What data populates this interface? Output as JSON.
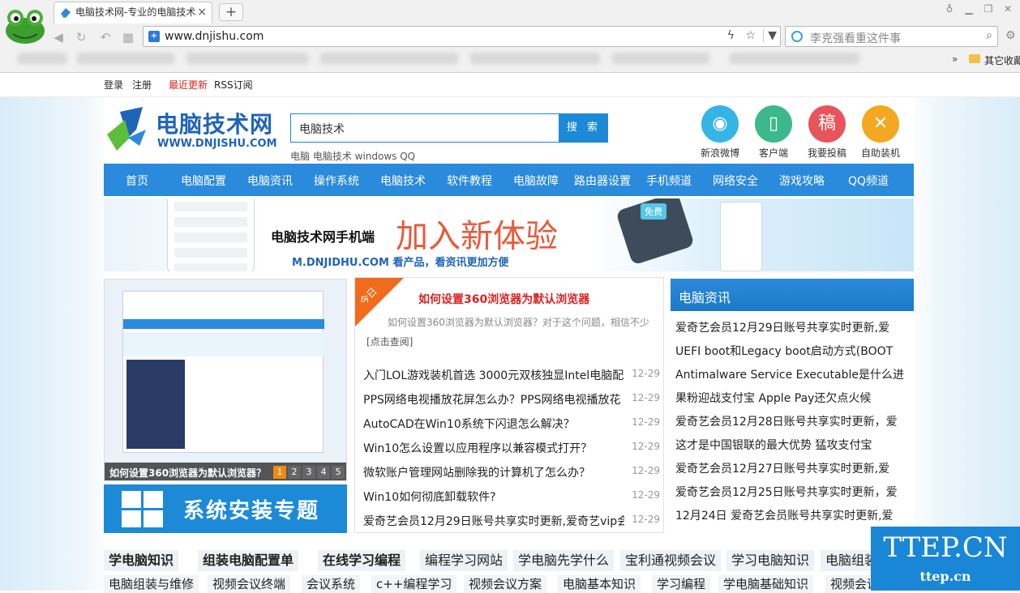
{
  "browser": {
    "tab_title": "电脑技术网-专业的电脑技术",
    "new_tab": "+",
    "url": "www.dnjishu.com",
    "search_placeholder": "李克强看重这件事",
    "bookmark_more": "»",
    "bookmark_other": "其它收藏"
  },
  "topbar": {
    "login": "登录",
    "register": "注册",
    "recent": "最近更新",
    "rss": "RSS订阅"
  },
  "site": {
    "logo_cn": "电脑技术网",
    "logo_en": "WWW.DNJISHU.COM",
    "search_value": "电脑技术",
    "search_button": "搜 索",
    "hot_words": "电脑 电脑技术 windows QQ",
    "quick_links": [
      {
        "label": "新浪微博",
        "icon": "weibo-icon",
        "color": "#35b4e6"
      },
      {
        "label": "客户端",
        "icon": "mobile-icon",
        "color": "#3cb88c"
      },
      {
        "label": "我要投稿",
        "icon": "submit-icon",
        "color": "#e9545a",
        "glyph": "稿"
      },
      {
        "label": "自助装机",
        "icon": "tools-icon",
        "color": "#f4a720"
      }
    ]
  },
  "nav": [
    "首页",
    "电脑配置",
    "电脑资讯",
    "操作系统",
    "电脑技术",
    "软件教程",
    "电脑故障",
    "路由器设置",
    "手机频道",
    "网络安全",
    "游戏攻略",
    "QQ频道"
  ],
  "banner": {
    "line1": "电脑技术网手机端",
    "line2": "加入新体验",
    "line3": "M.DNJIDHU.COM 看产品，看资讯更加方便",
    "free": "免费"
  },
  "slideshow": {
    "caption": "如何设置360浏览器为默认浏览器？",
    "pages": [
      "1",
      "2",
      "3",
      "4",
      "5"
    ],
    "active": 1
  },
  "promo": {
    "title": "系统安装专题"
  },
  "featured": {
    "badge": "今日",
    "headline": "如何设置360浏览器为默认浏览器",
    "summary": "如何设置360浏览器为默认浏览器？对于这个问题，相信不少",
    "more": "[点击查阅]",
    "articles": [
      {
        "title": "入门LOL游戏装机首选 3000元双核独显Intel电脑配",
        "date": "12-29"
      },
      {
        "title": "PPS网络电视播放花屏怎么办？PPS网络电视播放花",
        "date": "12-29"
      },
      {
        "title": "AutoCAD在Win10系统下闪退怎么解决？",
        "date": "12-29"
      },
      {
        "title": "Win10怎么设置以应用程序以兼容模式打开？",
        "date": "12-29"
      },
      {
        "title": "微软账户管理网站删除我的计算机了怎么办？",
        "date": "12-29"
      },
      {
        "title": "Win10如何彻底卸载软件?",
        "date": "12-29"
      },
      {
        "title": "爱奇艺会员12月29日账号共享实时更新,爱奇艺vip会",
        "date": "12-29"
      }
    ]
  },
  "news": {
    "title": "电脑资讯",
    "items": [
      "爱奇艺会员12月29日账号共享实时更新,爱",
      "UEFI boot和Legacy boot启动方式(BOOT",
      "Antimalware Service Executable是什么进",
      "果粉迎战支付宝 Apple Pay还欠点火候",
      "爱奇艺会员12月28日账号共享实时更新，爱",
      "这才是中国银联的最大优势 猛攻支付宝",
      "爱奇艺会员12月27日账号共享实时更新,爱",
      "爱奇艺会员12月25日账号共享实时更新，爱",
      "12月24日 爱奇艺会员账号共享实时更新,爱"
    ]
  },
  "tags_row1": [
    "学电脑知识",
    "组装电脑配置单",
    "在线学习编程",
    "编程学习网站",
    "学电脑先学什么",
    "宝利通视频会议",
    "学习电脑知识",
    "电脑组装"
  ],
  "tags_row2": [
    "电脑组装与维修",
    "视频会议终端",
    "会议系统",
    "c++编程学习",
    "视频会议方案",
    "电脑基本知识",
    "学习编程",
    "学电脑基础知识",
    "视频会议"
  ],
  "watermark": {
    "big": "TTEP.CN",
    "small": "ttep.cn"
  }
}
